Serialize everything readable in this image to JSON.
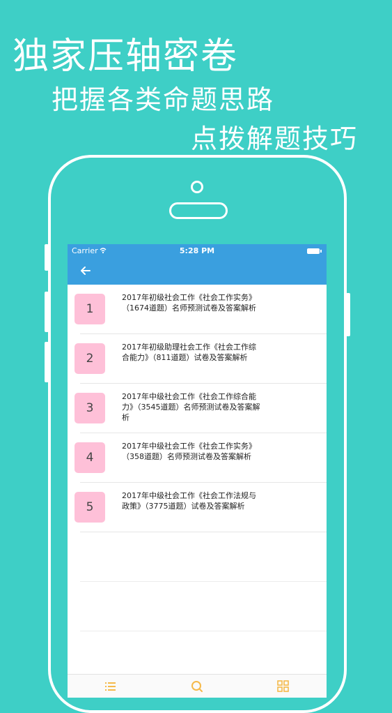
{
  "promo": {
    "line1": "独家压轴密卷",
    "line2": "把握各类命题思路",
    "line3": "点拨解题技巧"
  },
  "statusbar": {
    "carrier": "Carrier",
    "time": "5:28 PM"
  },
  "list": {
    "items": [
      {
        "number": "1",
        "title": "2017年初级社会工作《社会工作实务》（1674道题）名师预测试卷及答案解析"
      },
      {
        "number": "2",
        "title": "2017年初级助理社会工作《社会工作综合能力》（811道题）试卷及答案解析"
      },
      {
        "number": "3",
        "title": "2017年中级社会工作《社会工作综合能力》（3545道题）名师预测试卷及答案解析"
      },
      {
        "number": "4",
        "title": "2017年中级社会工作《社会工作实务》（358道题）名师预测试卷及答案解析"
      },
      {
        "number": "5",
        "title": "2017年中级社会工作《社会工作法规与政策》（3775道题）试卷及答案解析"
      }
    ]
  },
  "colors": {
    "background": "#3ecfc6",
    "navbar": "#3a9fdf",
    "badge": "#fec0d8",
    "tab_icon": "#f5b94a"
  },
  "icons": {
    "back": "arrow-left-icon",
    "tab_list": "list-icon",
    "tab_search": "search-icon",
    "tab_grid": "grid-icon"
  }
}
